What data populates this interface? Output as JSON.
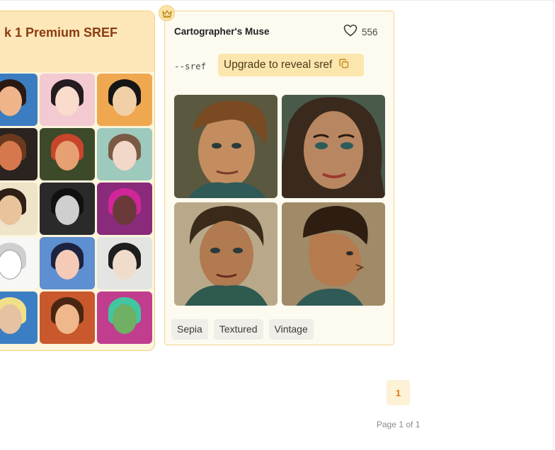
{
  "premium_card": {
    "title": "k 1 Premium SREF"
  },
  "style_card": {
    "title": "Cartographer's Muse",
    "likes": "556",
    "sref_label": "--sref",
    "upgrade_label": "Upgrade to reveal sref",
    "tags": [
      "Sepia",
      "Textured",
      "Vintage"
    ]
  },
  "pagination": {
    "current_page": "1",
    "page_info": "Page 1 of 1"
  },
  "icons": {
    "crown": "crown-icon",
    "heart": "heart-icon",
    "copy": "copy-icon"
  },
  "colors": {
    "accent": "#d77a1a",
    "premium_border": "#f3cf7a",
    "upgrade_bg": "#fbe6ad"
  }
}
